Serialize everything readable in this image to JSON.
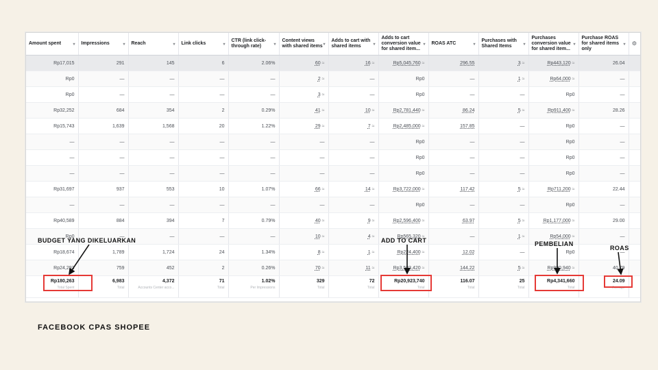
{
  "columns": [
    "Amount spent",
    "Impressions",
    "Reach",
    "Link clicks",
    "CTR (link click-through rate)",
    "Content views with shared items",
    "Adds to cart with shared items",
    "Adds to cart conversion value for shared item...",
    "ROAS ATC",
    "Purchases with Shared Items",
    "Purchases conversion value for shared item...",
    "Purchase ROAS for shared items only"
  ],
  "settings_icon": "gear-icon",
  "rows": [
    [
      "Rp17,015",
      "291",
      "145",
      "6",
      "2.06%",
      "60",
      "16",
      "Rp5,045,760",
      "296.55",
      "3",
      "Rp443,120",
      "26.04"
    ],
    [
      "Rp0",
      "—",
      "—",
      "—",
      "—",
      "2",
      "—",
      "Rp0",
      "—",
      "1",
      "Rp64,000",
      "—"
    ],
    [
      "Rp0",
      "—",
      "—",
      "—",
      "—",
      "3",
      "—",
      "Rp0",
      "—",
      "—",
      "Rp0",
      "—"
    ],
    [
      "Rp32,252",
      "684",
      "354",
      "2",
      "0.29%",
      "41",
      "10",
      "Rp2,781,440",
      "86.24",
      "5",
      "Rp911,400",
      "28.26"
    ],
    [
      "Rp15,743",
      "1,639",
      "1,568",
      "20",
      "1.22%",
      "29",
      "7",
      "Rp2,485,000",
      "157.85",
      "—",
      "Rp0",
      "—"
    ],
    [
      "—",
      "—",
      "—",
      "—",
      "—",
      "—",
      "—",
      "Rp0",
      "—",
      "—",
      "Rp0",
      "—"
    ],
    [
      "—",
      "—",
      "—",
      "—",
      "—",
      "—",
      "—",
      "Rp0",
      "—",
      "—",
      "Rp0",
      "—"
    ],
    [
      "—",
      "—",
      "—",
      "—",
      "—",
      "—",
      "—",
      "Rp0",
      "—",
      "—",
      "Rp0",
      "—"
    ],
    [
      "Rp31,697",
      "937",
      "553",
      "10",
      "1.07%",
      "66",
      "14",
      "Rp3,722,000",
      "117.42",
      "5",
      "Rp711,200",
      "22.44"
    ],
    [
      "—",
      "—",
      "—",
      "—",
      "—",
      "—",
      "—",
      "Rp0",
      "—",
      "—",
      "Rp0",
      "—"
    ],
    [
      "Rp40,589",
      "884",
      "394",
      "7",
      "0.79%",
      "40",
      "9",
      "Rp2,596,400",
      "63.97",
      "5",
      "Rp1,177,000",
      "29.00"
    ],
    [
      "Rp0",
      "—",
      "—",
      "—",
      "—",
      "10",
      "4",
      "Rp565,320",
      "—",
      "1",
      "Rp54,000",
      "—"
    ],
    [
      "Rp18,674",
      "1,789",
      "1,724",
      "24",
      "1.34%",
      "8",
      "1",
      "Rp224,400",
      "12.02",
      "—",
      "Rp0",
      "—"
    ],
    [
      "Rp24,293",
      "759",
      "452",
      "2",
      "0.26%",
      "70",
      "11",
      "Rp3,503,420",
      "144.22",
      "5",
      "Rp990,940",
      "40.79"
    ]
  ],
  "totals": [
    {
      "value": "Rp180,263",
      "sub": "Total Spent"
    },
    {
      "value": "6,983",
      "sub": "Total"
    },
    {
      "value": "4,372",
      "sub": "Accounts Center acco..."
    },
    {
      "value": "71",
      "sub": "Total"
    },
    {
      "value": "1.02%",
      "sub": "Per Impressions"
    },
    {
      "value": "329",
      "sub": "Total"
    },
    {
      "value": "72",
      "sub": "Total"
    },
    {
      "value": "Rp20,923,740",
      "sub": "Total"
    },
    {
      "value": "116.07",
      "sub": "Total"
    },
    {
      "value": "25",
      "sub": "Total"
    },
    {
      "value": "Rp4,341,660",
      "sub": "Total"
    },
    {
      "value": "24.09",
      "sub": "Average"
    }
  ],
  "annotations": {
    "budget": "BUDGET YANG DIKELUARKAN",
    "add_to_cart": "ADD TO CART",
    "purchase": "PEMBELIAN",
    "roas": "ROAS"
  },
  "footer": "FACEBOOK CPAS SHOPEE",
  "colors": {
    "highlight_box": "#e53935",
    "background": "#f6f1e7"
  }
}
